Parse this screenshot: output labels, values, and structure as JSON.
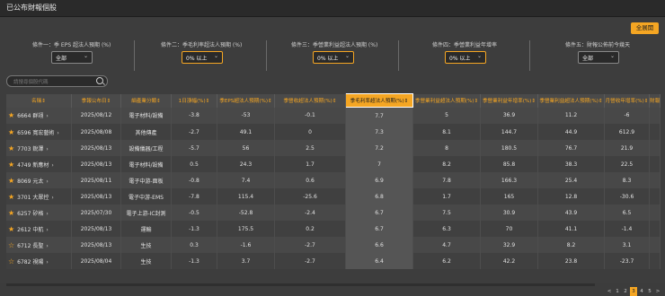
{
  "title": "已公布財報個股",
  "all_button": "全展開",
  "filters": [
    {
      "label": "條件一：季 EPS 超法人預期 (%)",
      "value": "全部"
    },
    {
      "label": "條件二：季毛利率超法人預期 (%)",
      "value": "0% 以上"
    },
    {
      "label": "條件三：季營業利益超法人預期 (%)",
      "value": "0% 以上"
    },
    {
      "label": "條件四：季營業利益年增率",
      "value": "0% 以上"
    },
    {
      "label": "條件五：財報公佈前今幾天",
      "value": "全部"
    }
  ],
  "search_placeholder": "請搜尋個股代碼",
  "columns": [
    "名稱",
    "季報公布日",
    "細產業分類",
    "1日漲幅(%)",
    "季EPS超法人預期(%)",
    "季營收超法人預期(%)",
    "季毛利率超法人預期(%)",
    "季營業利益超法人預期(%)",
    "季營業利益年增率(%)",
    "季營業利益超法人預期(%)",
    "月營收年增率(%)",
    "財報"
  ],
  "rows": [
    {
      "name": "6664 群翊",
      "date": "2025/08/12",
      "industry": "電子材料/設備",
      "c1": "-3.8",
      "c2": "-53",
      "c3": "-0.1",
      "c4": "7.7",
      "c5": "5",
      "c6": "36.9",
      "c7": "11.2",
      "c8": "-6",
      "star": "filled"
    },
    {
      "name": "6596 寬宏藝術",
      "date": "2025/08/08",
      "industry": "其他傳產",
      "c1": "-2.7",
      "c2": "49.1",
      "c3": "0",
      "c4": "7.3",
      "c5": "8.1",
      "c6": "144.7",
      "c7": "44.9",
      "c8": "612.9",
      "star": "filled"
    },
    {
      "name": "7703 銳澤",
      "date": "2025/08/13",
      "industry": "設備儀器/工程",
      "c1": "-5.7",
      "c2": "56",
      "c3": "2.5",
      "c4": "7.2",
      "c5": "8",
      "c6": "180.5",
      "c7": "76.7",
      "c8": "21.9",
      "star": "filled"
    },
    {
      "name": "4749 新應材",
      "date": "2025/08/13",
      "industry": "電子材料/設備",
      "c1": "0.5",
      "c2": "24.3",
      "c3": "1.7",
      "c4": "7",
      "c5": "8.2",
      "c6": "85.8",
      "c7": "38.3",
      "c8": "22.5",
      "star": "filled"
    },
    {
      "name": "8069 元太",
      "date": "2025/08/11",
      "industry": "電子中游-面板",
      "c1": "-0.8",
      "c2": "7.4",
      "c3": "0.6",
      "c4": "6.9",
      "c5": "7.8",
      "c6": "166.3",
      "c7": "25.4",
      "c8": "8.3",
      "star": "filled"
    },
    {
      "name": "3701 大眾控",
      "date": "2025/08/13",
      "industry": "電子中游-EMS",
      "c1": "-7.8",
      "c2": "115.4",
      "c3": "-25.6",
      "c4": "6.8",
      "c5": "1.7",
      "c6": "165",
      "c7": "12.8",
      "c8": "-30.6",
      "star": "filled"
    },
    {
      "name": "6257 矽格",
      "date": "2025/07/30",
      "industry": "電子上游-IC封測",
      "c1": "-0.5",
      "c2": "-52.8",
      "c3": "-2.4",
      "c4": "6.7",
      "c5": "7.5",
      "c6": "30.9",
      "c7": "43.9",
      "c8": "6.5",
      "star": "filled"
    },
    {
      "name": "2612 中航",
      "date": "2025/08/13",
      "industry": "運輸",
      "c1": "-1.3",
      "c2": "175.5",
      "c3": "0.2",
      "c4": "6.7",
      "c5": "6.3",
      "c6": "70",
      "c7": "41.1",
      "c8": "-1.4",
      "star": "filled"
    },
    {
      "name": "6712 長聖",
      "date": "2025/08/13",
      "industry": "生技",
      "c1": "0.3",
      "c2": "-1.6",
      "c3": "-2.7",
      "c4": "6.6",
      "c5": "4.7",
      "c6": "32.9",
      "c7": "8.2",
      "c8": "3.1",
      "star": "outline"
    },
    {
      "name": "6782 視陽",
      "date": "2025/08/04",
      "industry": "生技",
      "c1": "-1.3",
      "c2": "3.7",
      "c3": "-2.7",
      "c4": "6.4",
      "c5": "6.2",
      "c6": "42.2",
      "c7": "23.8",
      "c8": "-23.7",
      "star": "outline"
    }
  ],
  "pager": {
    "prev": "<",
    "pages": [
      "1",
      "2",
      "3",
      "4",
      "5"
    ],
    "current": "3",
    "next": ">"
  },
  "accent": "#f5a623"
}
